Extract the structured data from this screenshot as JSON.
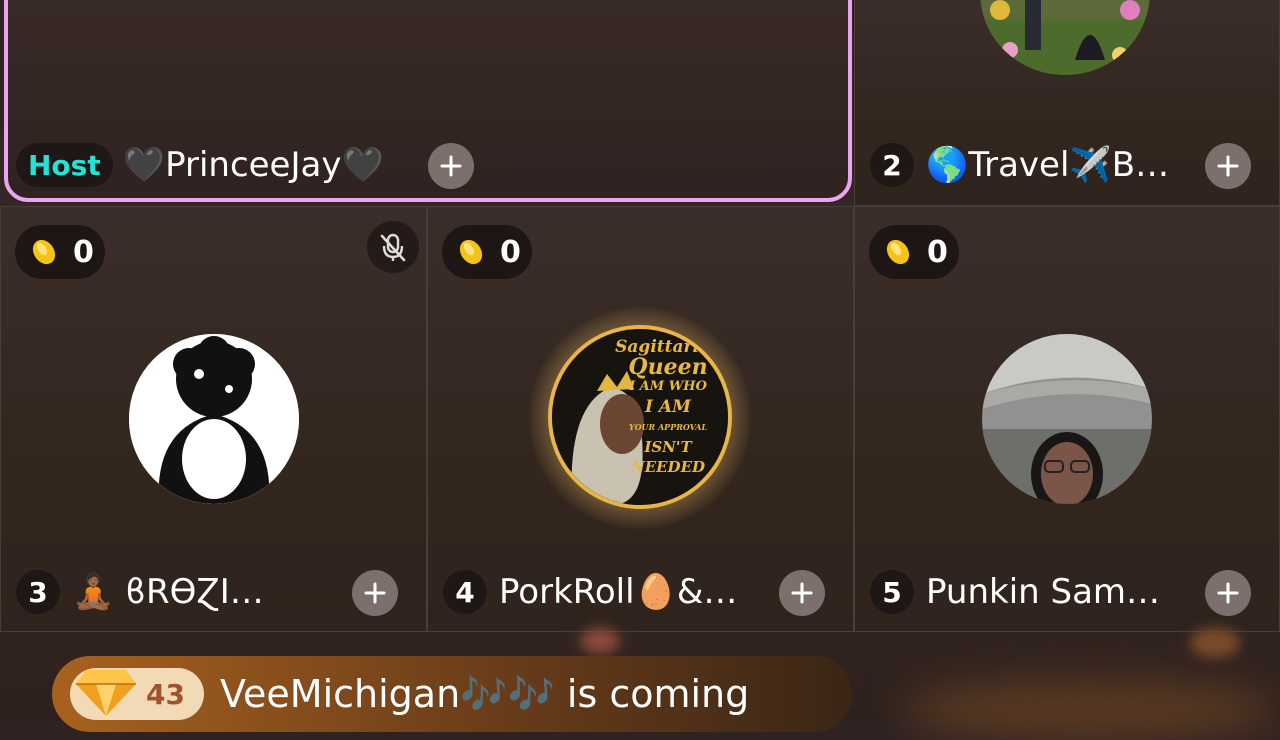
{
  "host_tile": {
    "badge": "Host",
    "name": "🖤PrinceeJay🖤"
  },
  "seats": [
    {
      "number": "2",
      "name": "🌎Travel✈️B…"
    },
    {
      "number": "3",
      "name": "🧘🏾 ϐRϴⱿI…",
      "coins": "0",
      "muted": true
    },
    {
      "number": "4",
      "name": "PorkRoll🥚&…",
      "coins": "0",
      "avatar_text": [
        "Sagittarius",
        "Queen",
        "I AM WHO",
        "I AM",
        "YOUR APPROVAL",
        "ISN'T",
        "NEEDED"
      ]
    },
    {
      "number": "5",
      "name": "Punkin Sam…",
      "coins": "0"
    }
  ],
  "entry_banner": {
    "level": "43",
    "text": "VeeMichigan🎶🎶 is coming"
  },
  "icons": {
    "coin": "coin-icon",
    "mute": "mic-off-icon",
    "follow": "plus-icon",
    "level": "diamond-icon"
  },
  "colors": {
    "host_border": "#e9a6ee",
    "host_badge": "#24e3d6",
    "banner": "#a8621e"
  }
}
